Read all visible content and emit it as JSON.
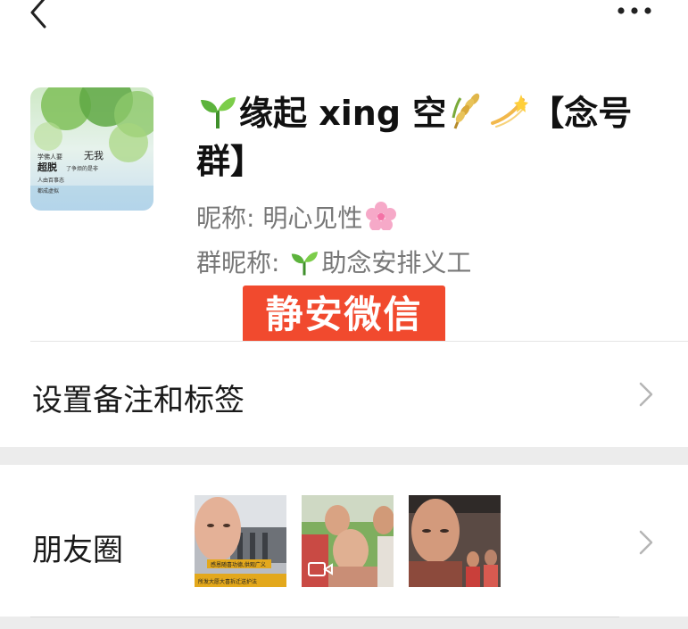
{
  "header": {
    "back_icon": "chevron-left-icon",
    "more_icon": "more-horizontal-icon"
  },
  "profile": {
    "avatar_alt": "profile avatar image",
    "name_part1": "缘起 xing 空",
    "name_part2": "【念号",
    "name_part3": "群】",
    "nickname_label": "昵称:",
    "nickname_value": "明心见性",
    "group_nickname_label": "群昵称:",
    "group_nickname_value": "助念安排义工",
    "avatar_text": {
      "line1": "学佛人要",
      "line2": "超脱",
      "line3": "无我",
      "line4": "了争烦的是非",
      "line5": "人由百事态",
      "line6": "都成虚拟"
    }
  },
  "watermark": {
    "text": "静安微信"
  },
  "menu": {
    "remark_label": "设置备注和标签",
    "moments_label": "朋友圈"
  },
  "moments": {
    "thumb1_caption_top": "感恩随喜功德,供观广义",
    "thumb1_caption_bottom": "所发大愿大喜拆迁送护法"
  },
  "colors": {
    "watermark_bg": "#f14a2e",
    "section_gap": "#ececec",
    "secondary_text": "#777777"
  }
}
